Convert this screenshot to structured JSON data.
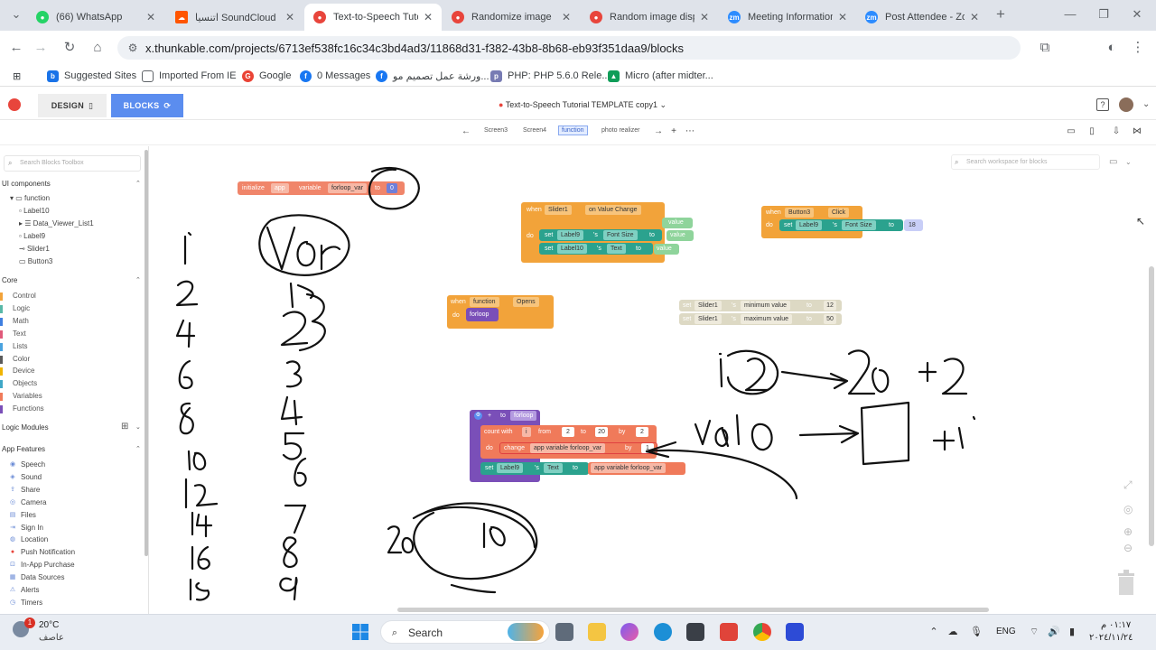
{
  "browser": {
    "tabs": [
      {
        "title": "(66) WhatsApp",
        "color": "#25d366"
      },
      {
        "title": "اتنسيا SoundCloud",
        "color": "#ff5500"
      },
      {
        "title": "Text-to-Speech Tuto",
        "color": "#e8453c"
      },
      {
        "title": "Randomize image",
        "color": "#e8453c"
      },
      {
        "title": "Random image displ",
        "color": "#e8453c"
      },
      {
        "title": "Meeting Information",
        "color": "#2d8cff"
      },
      {
        "title": "Post Attendee - Zoo",
        "color": "#2d8cff"
      }
    ],
    "url": "x.thunkable.com/projects/6713ef538fc16c34c3bd4ad3/11868d31-f382-43b8-8b68-eb93f351daa9/blocks",
    "bookmarks": [
      {
        "label": "Suggested Sites",
        "color": "#1a73e8"
      },
      {
        "label": "Imported From IE",
        "color": "#5f6368"
      },
      {
        "label": "Google",
        "color": "#ea4335"
      },
      {
        "label": "0 Messages",
        "color": "#1877f2"
      },
      {
        "label": "ورشة عمل تصميم مو...",
        "color": "#1877f2"
      },
      {
        "label": "PHP: PHP 5.6.0 Rele...",
        "color": "#777bb3"
      },
      {
        "label": "Micro (after midter...",
        "color": "#0f9d58"
      }
    ]
  },
  "app": {
    "design_label": "DESIGN",
    "blocks_label": "BLOCKS",
    "project_title": "Text-to-Speech Tutorial TEMPLATE copy1",
    "screens": [
      "Screen3",
      "Screen4",
      "function",
      "photo realizer"
    ]
  },
  "sidebar": {
    "search_placeholder": "Search Blocks Toolbox",
    "ui_components_label": "UI components",
    "tree": [
      "function",
      "Label10",
      "Data_Viewer_List1",
      "Label9",
      "Slider1",
      "Button3"
    ],
    "core_label": "Core",
    "core": [
      {
        "label": "Control",
        "color": "#f2a33a"
      },
      {
        "label": "Logic",
        "color": "#58b8a7"
      },
      {
        "label": "Math",
        "color": "#3f7fe0"
      },
      {
        "label": "Text",
        "color": "#e05a7a"
      },
      {
        "label": "Lists",
        "color": "#4aa3df"
      },
      {
        "label": "Color",
        "color": "#5a5a5a"
      },
      {
        "label": "Device",
        "color": "#f0b400"
      },
      {
        "label": "Objects",
        "color": "#3fa7c7"
      },
      {
        "label": "Variables",
        "color": "#f07a5a"
      },
      {
        "label": "Functions",
        "color": "#7a4fb8"
      }
    ],
    "logic_modules_label": "Logic Modules",
    "app_features_label": "App Features",
    "features": [
      "Speech",
      "Sound",
      "Share",
      "Camera",
      "Files",
      "Sign In",
      "Location",
      "Push Notification",
      "In-App Purchase",
      "Data Sources",
      "Alerts",
      "Timers"
    ]
  },
  "workspace": {
    "search_placeholder": "Search workspace for blocks",
    "init_block": {
      "initialize": "initialize",
      "app": "app",
      "variable": "variable",
      "name": "forloop_var",
      "to": "to",
      "value": "0"
    },
    "slider_block": {
      "when": "when",
      "component": "Slider1",
      "event": "on Value Change",
      "do": "do",
      "value1": "value",
      "set": "set",
      "label9": "Label9",
      "s": "'s",
      "prop1": "Font Size",
      "to": "to",
      "value2": "value",
      "label10": "Label10",
      "prop2": "Text",
      "value3": "value"
    },
    "button_block": {
      "when": "when",
      "component": "Button3",
      "event": "Click",
      "do": "do",
      "set": "set",
      "label": "Label9",
      "s": "'s",
      "prop": "Font Size",
      "to": "to",
      "value": "18"
    },
    "opens_block": {
      "when": "when",
      "component": "function",
      "event": "Opens",
      "do": "do",
      "call": "forloop"
    },
    "slider_props": [
      {
        "set": "set",
        "component": "Slider1",
        "s": "'s",
        "prop": "minimum value",
        "to": "to",
        "value": "12"
      },
      {
        "set": "set",
        "component": "Slider1",
        "s": "'s",
        "prop": "maximum value",
        "to": "to",
        "value": "50"
      }
    ],
    "func_block": {
      "to": "to",
      "name": "forloop",
      "count_with": "count with",
      "var": "i",
      "from": "from",
      "from_val": "2",
      "to_label": "to",
      "to_val": "20",
      "by": "by",
      "by_val": "2",
      "do": "do",
      "change": "change",
      "change_var": "app variable forloop_var",
      "by2": "by",
      "by2_val": "1",
      "set": "set",
      "label": "Label9",
      "s": "'s",
      "prop": "Text",
      "to2": "to",
      "text_var": "app variable forloop_var"
    }
  },
  "taskbar": {
    "temperature": "20°C",
    "weather": "عاصف",
    "weather_badge": "1",
    "search_label": "Search",
    "language": "ENG",
    "time": "٠١:١٧ م",
    "date": "٢٠٢٤/١١/٢٤"
  }
}
